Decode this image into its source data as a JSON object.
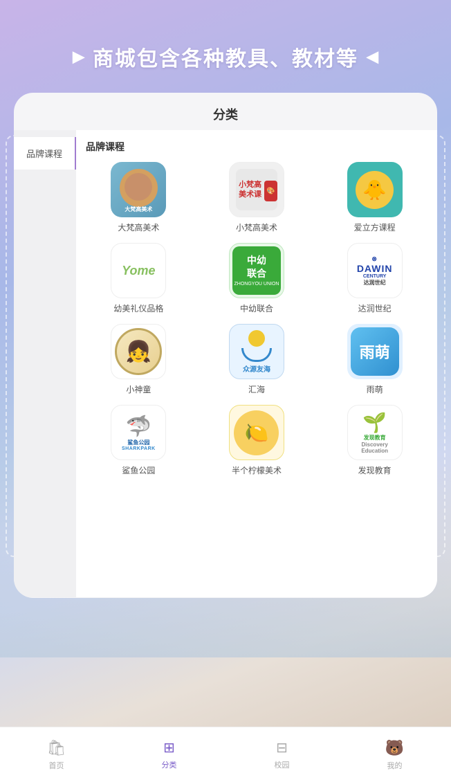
{
  "header": {
    "arrow_left": "▶",
    "arrow_right": "◀",
    "title": "商城包含各种教具、教材等"
  },
  "card": {
    "title": "分类",
    "sidebar_items": [
      {
        "label": "品牌课程",
        "active": true
      }
    ],
    "section_title": "品牌课程",
    "brands": [
      {
        "name": "大梵高美术",
        "color": "#6baac8",
        "type": "dafan"
      },
      {
        "name": "小梵高美术",
        "color": "#f0f0f0",
        "type": "xiaofan"
      },
      {
        "name": "爱立方课程",
        "color": "#40b8b0",
        "type": "ailf"
      },
      {
        "name": "幼美礼仪品格",
        "color": "#ffffff",
        "type": "youmei"
      },
      {
        "name": "中幼联合",
        "color": "#e8f8e8",
        "type": "zhongyou"
      },
      {
        "name": "达润世纪",
        "color": "#ffffff",
        "type": "dawin"
      },
      {
        "name": "小神童",
        "color": "#ffffff",
        "type": "xiaoshen"
      },
      {
        "name": "汇海",
        "color": "#e8f4ff",
        "type": "huihai"
      },
      {
        "name": "雨萌",
        "color": "#e0f0ff",
        "type": "yumeng"
      },
      {
        "name": "鲨鱼公园",
        "color": "#ffffff",
        "type": "shark"
      },
      {
        "name": "半个柠檬美术",
        "color": "#fff8e0",
        "type": "lemon"
      },
      {
        "name": "发现教育",
        "color": "#ffffff",
        "type": "discover"
      }
    ]
  },
  "tabs": [
    {
      "label": "首页",
      "icon": "🛍",
      "active": false
    },
    {
      "label": "分类",
      "icon": "⊞",
      "active": true
    },
    {
      "label": "校园",
      "icon": "⊟",
      "active": false
    },
    {
      "label": "我的",
      "icon": "🐻",
      "active": false
    }
  ]
}
